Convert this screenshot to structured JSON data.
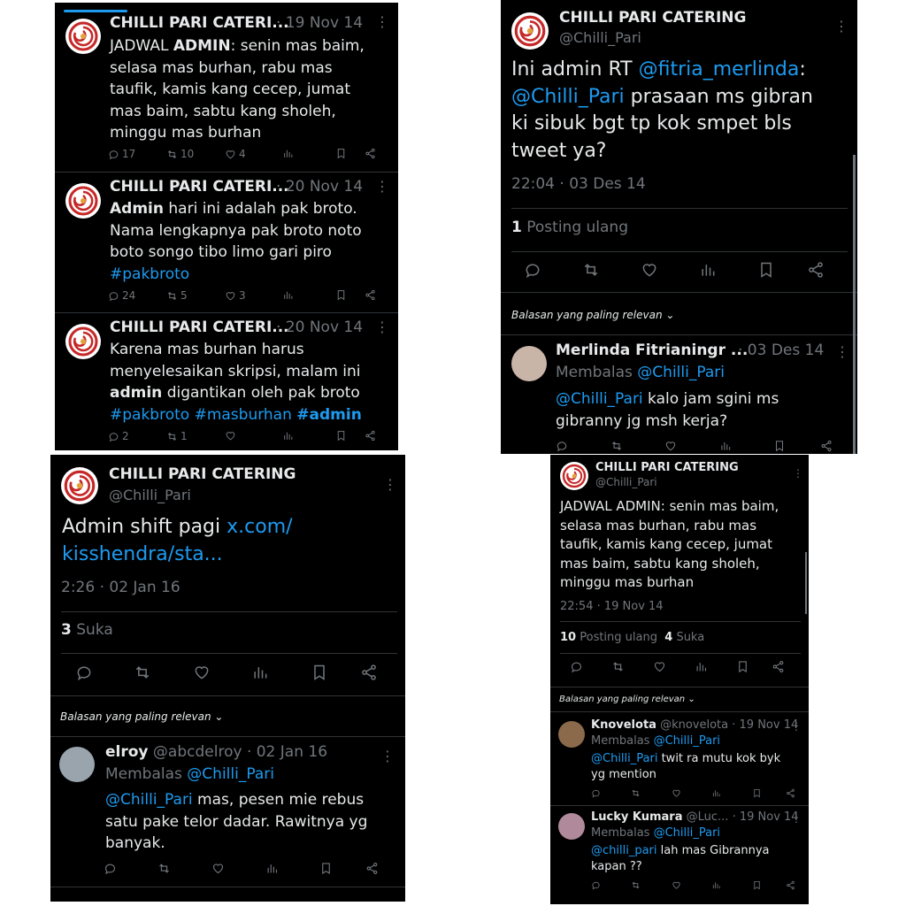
{
  "brand": {
    "name_short": "CHILLI PARI CATERI...",
    "name": "CHILLI PARI CATERING",
    "handle": "@Chilli_Pari"
  },
  "colors": {
    "bg": "#000000",
    "text": "#e7e9ea",
    "muted": "#71767b",
    "link": "#1d9bf0",
    "brand_red": "#c62828"
  },
  "icons": [
    "reply-icon",
    "retweet-icon",
    "like-icon",
    "views-icon",
    "bookmark-icon",
    "share-icon",
    "more-icon",
    "chevron-down-icon"
  ],
  "panel1": {
    "tweets": [
      {
        "date": "· 19 Nov 14",
        "text": {
          "a": "JADWAL ",
          "b": "ADMIN",
          "c": ": senin mas baim, selasa mas burhan, rabu mas taufik, kamis kang cecep, jumat mas baim, sabtu kang sholeh, minggu mas burhan"
        },
        "replies": "17",
        "retweets": "10",
        "likes": "4"
      },
      {
        "date": "· 20 Nov 14",
        "text": {
          "b": "Admin",
          "c": " hari ini adalah pak broto. Nama lengkapnya pak broto noto boto songo tibo limo gari piro",
          "tag": "#pakbroto"
        },
        "replies": "24",
        "retweets": "5",
        "likes": "3"
      },
      {
        "date": "· 20 Nov 14",
        "text": {
          "a": "Karena mas burhan harus menyelesaikan skripsi, malam ini ",
          "b": "admin",
          "c": " digantikan oleh pak broto",
          "tag1": "#pakbroto #masburhan ",
          "tag2": "#admin"
        },
        "replies": "2",
        "retweets": "1",
        "likes": ""
      }
    ]
  },
  "panel2": {
    "text": {
      "a": "Ini admin RT ",
      "m1": "@fitria_merlinda",
      "b": ":",
      "m2": "@Chilli_Pari",
      "c": " prasaan ms gibran ki sibuk bgt tp kok smpet bls tweet ya?"
    },
    "timestamp": "22:04 · 03 Des 14",
    "stat_num": "1",
    "stat_label": "Posting ulang",
    "relevan": "Balasan yang paling relevan",
    "reply": {
      "name": "Merlinda Fitrianingr ...",
      "date": "· 03 Des 14",
      "membalas": "Membalas ",
      "mention": "@Chilli_Pari",
      "mention2": "@Chilli_Pari",
      "text": "  kalo jam sgini ms gibranny jg msh kerja?"
    }
  },
  "panel3": {
    "text": {
      "a": "Admin shift pagi ",
      "link": "x.com/ kisshendra/sta..."
    },
    "timestamp": "2:26 · 02 Jan 16",
    "stat_num": "3",
    "stat_label": "Suka",
    "relevan": "Balasan yang paling relevan",
    "reply": {
      "name": "elroy",
      "handle": "@abcdelroy",
      "date": "· 02 Jan 16",
      "membalas": "Membalas ",
      "mention": "@Chilli_Pari",
      "mention2": "@Chilli_Pari",
      "text": " mas, pesen mie rebus satu pake telor dadar. Rawitnya yg banyak."
    }
  },
  "panel4": {
    "text": "JADWAL ADMIN: senin mas baim, selasa mas burhan, rabu mas taufik, kamis kang cecep, jumat mas baim, sabtu kang sholeh, minggu mas burhan",
    "timestamp": "22:54 · 19 Nov 14",
    "stat1_num": "10",
    "stat1_label": "Posting ulang",
    "stat2_num": "4",
    "stat2_label": "Suka",
    "relevan": "Balasan yang paling relevan",
    "replies": [
      {
        "name": "Knovelota",
        "handle": "@knovelota",
        "date": "· 19 Nov 14",
        "membalas": "Membalas ",
        "mention": "@Chilli_Pari",
        "mention2": "@Chilli_Pari",
        "text": " twit ra mutu kok byk yg mention"
      },
      {
        "name": "Lucky Kumara",
        "handle": "@Luc...",
        "date": "· 19 Nov 14",
        "membalas": "Membalas ",
        "mention": "@Chilli_Pari",
        "mention2": "@chilli_pari",
        "text": " lah mas Gibrannya kapan ??"
      }
    ]
  }
}
